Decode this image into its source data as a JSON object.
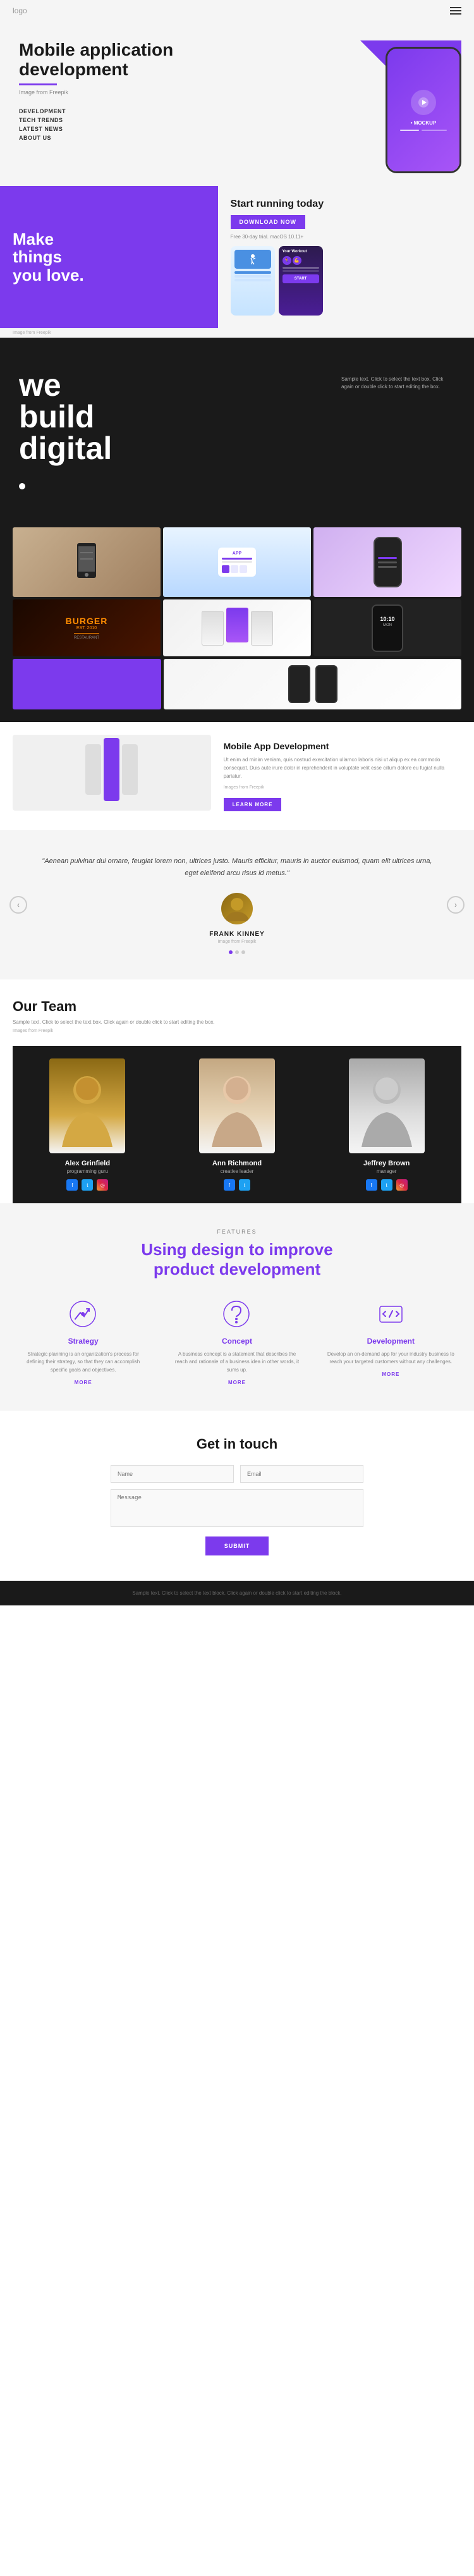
{
  "header": {
    "logo": "logo",
    "menu_icon": "≡"
  },
  "hero": {
    "title": "Mobile application development",
    "subtitle": "Image from Freepik",
    "nav": [
      "DEVELOPMENT",
      "TECH TRENDS",
      "LATEST NEWS",
      "ABOUT US"
    ],
    "phone_mockup_label": "• MOCKUP"
  },
  "section2": {
    "headline": "Make things you love.",
    "running_title": "Start running today",
    "download_btn": "DOWNLOAD NOW",
    "trial_text": "Free 30-day trial. macOS 10.11+",
    "image_credit": "Image from Freepik"
  },
  "section3": {
    "headline_line1": "we",
    "headline_line2": "build",
    "headline_line3": "digital",
    "description": "Sample text. Click to select the text box. Click again or double click to start editing the box."
  },
  "portfolio": {
    "mobile_dev_title": "Mobile App Development",
    "mobile_dev_desc": "Ut enim ad minim veniam, quis nostrud exercitation ullamco laboris nisi ut aliqup ex ea commodo consequat. Duis aute irure dolor in reprehenderit in voluptate velit esse cillum dolore eu fugiat nulla pariatur.",
    "image_credit": "Images from Freepik",
    "learn_more": "LEARN MORE"
  },
  "testimonial": {
    "quote": "\"Aenean pulvinar dui ornare, feugiat lorem non, ultrices justo. Mauris efficitur, mauris in auctor euismod, quam elit ultrices urna, eget eleifend arcu risus id metus.\"",
    "name": "FRANK KINNEY",
    "credit": "Image from Freepik"
  },
  "team": {
    "title": "Our Team",
    "description": "Sample text. Click to select the text box. Click again or double click to start editing the box.",
    "credit": "Images from Freepik",
    "members": [
      {
        "name": "Alex Grinfield",
        "role": "programming guru"
      },
      {
        "name": "Ann Richmond",
        "role": "creative leader"
      },
      {
        "name": "Jeffrey Brown",
        "role": "manager"
      }
    ]
  },
  "features": {
    "label": "FEATURES",
    "title_line1": "Using design to improve",
    "title_line2": "product development",
    "items": [
      {
        "title": "Strategy",
        "desc": "Strategic planning is an organization's process for defining their strategy, so that they can accomplish specific goals and objectives.",
        "link": "MORE"
      },
      {
        "title": "Concept",
        "desc": "A business concept is a statement that describes the reach and rationale of a business idea in other words, it sums up.",
        "link": "MORE"
      },
      {
        "title": "Development",
        "desc": "Develop an on-demand app for your industry business to reach your targeted customers without any challenges.",
        "link": "MORE"
      }
    ]
  },
  "contact": {
    "title": "Get in touch",
    "fields": {
      "name_placeholder": "Name",
      "email_placeholder": "Email",
      "message_placeholder": "Message"
    },
    "submit_btn": "SUBMIT"
  },
  "footer": {
    "text": "Sample text. Click to select the text block. Click again or double click to start editing the block."
  }
}
